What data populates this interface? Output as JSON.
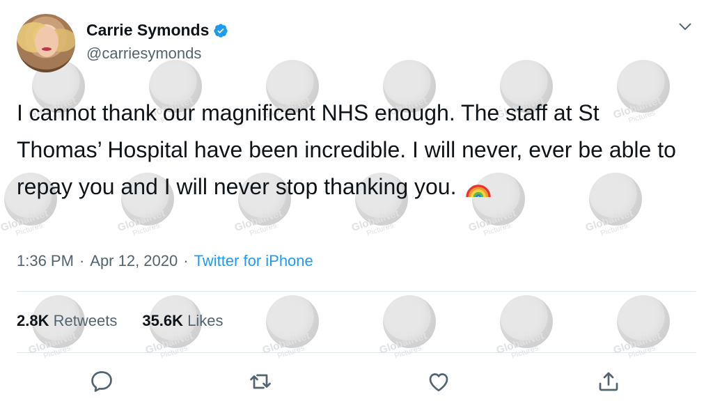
{
  "user": {
    "display_name": "Carrie Symonds",
    "handle": "@carriesymonds",
    "verified": true
  },
  "tweet": {
    "text": "I cannot thank our magnificent NHS enough. The staff at St Thomas’ Hospital have been incredible. I will never, ever be able to repay you and I will never stop thanking you.",
    "emoji": "rainbow-emoji"
  },
  "meta": {
    "time": "1:36 PM",
    "separator": "·",
    "date": "Apr 12, 2020",
    "source": "Twitter for iPhone"
  },
  "stats": {
    "retweets_count": "2.8K",
    "retweets_label": "Retweets",
    "likes_count": "35.6K",
    "likes_label": "Likes"
  },
  "watermark": {
    "brand": "GlobalNet",
    "sub": "Pictures"
  },
  "icons": [
    "verified-badge-icon",
    "chevron-down-icon",
    "reply-icon",
    "retweet-icon",
    "like-icon",
    "share-icon"
  ],
  "colors": {
    "accent": "#1d9bf0",
    "secondary_text": "#536471",
    "primary_text": "#0f1419"
  }
}
